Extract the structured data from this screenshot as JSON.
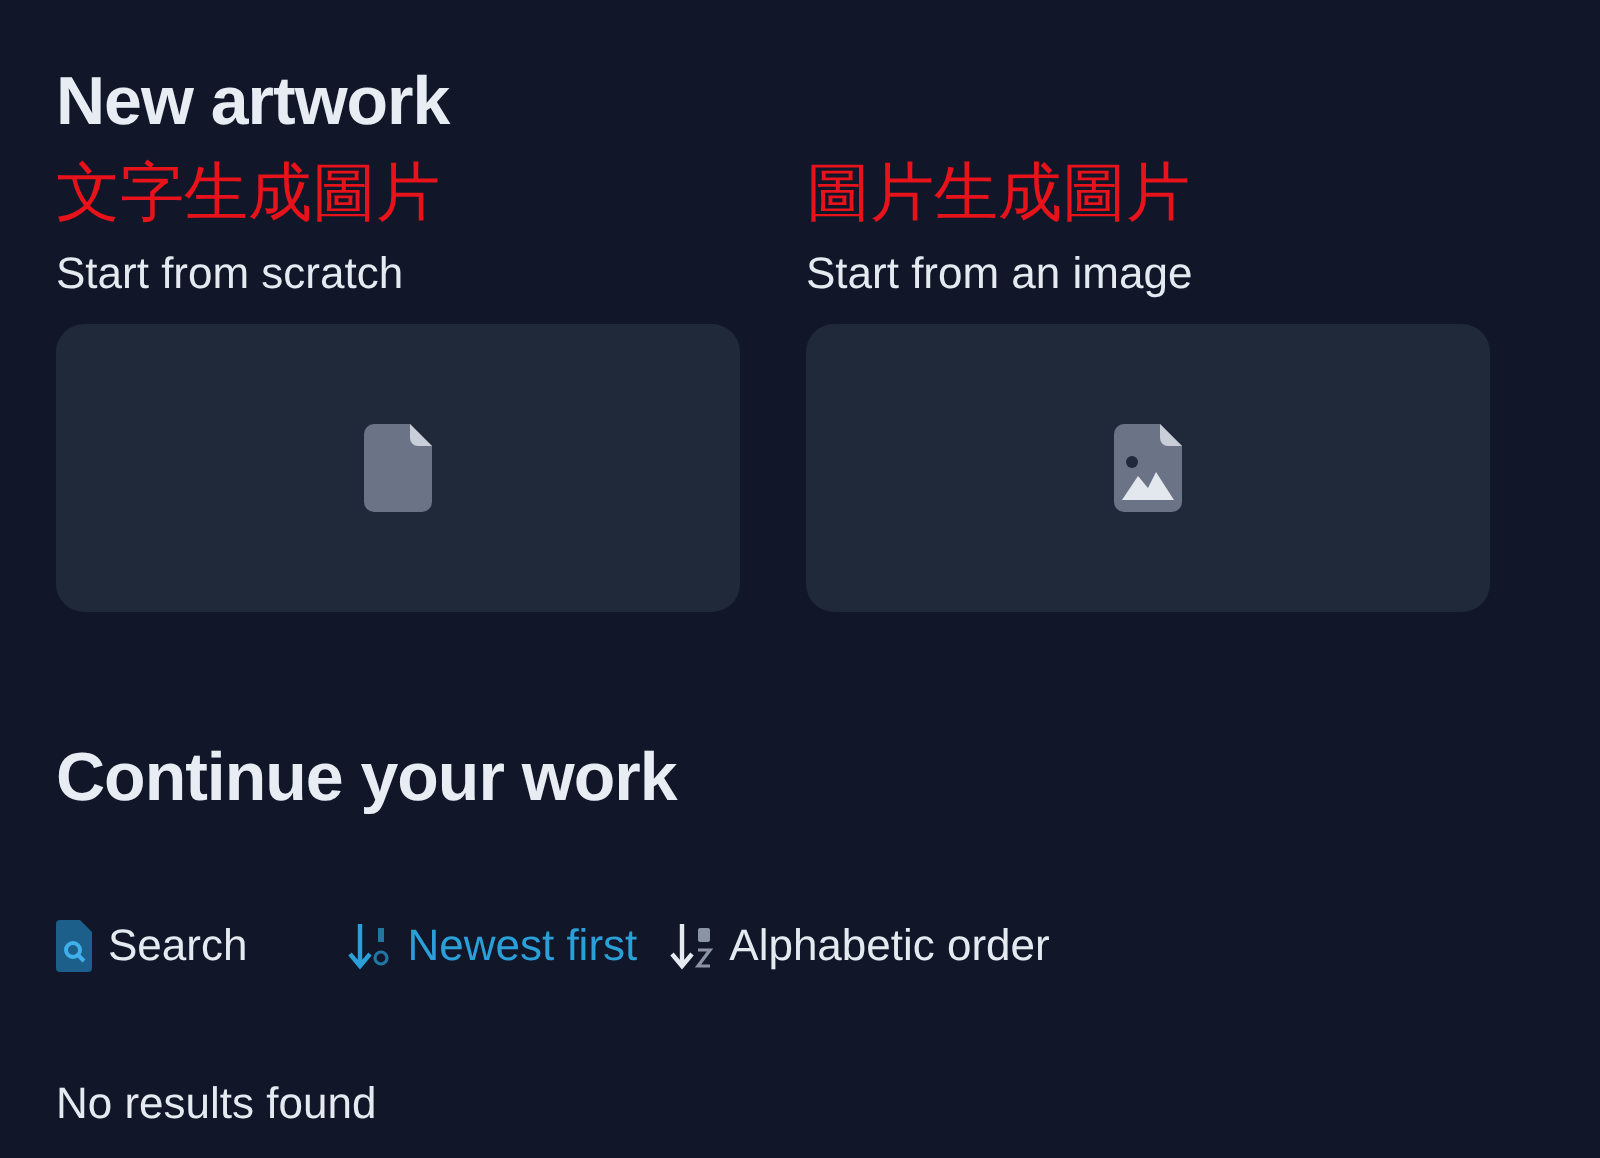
{
  "new_artwork": {
    "title": "New artwork",
    "options": [
      {
        "annotation": "文字生成圖片",
        "label": "Start from scratch",
        "kind": "blank"
      },
      {
        "annotation": "圖片生成圖片",
        "label": "Start from an image",
        "kind": "image"
      }
    ]
  },
  "continue": {
    "title": "Continue your work",
    "search": {
      "label": "Search"
    },
    "sort_options": [
      {
        "label": "Newest first",
        "kind": "date",
        "selected": true
      },
      {
        "label": "Alphabetic order",
        "kind": "alpha",
        "selected": false
      }
    ],
    "empty_message": "No results found"
  }
}
